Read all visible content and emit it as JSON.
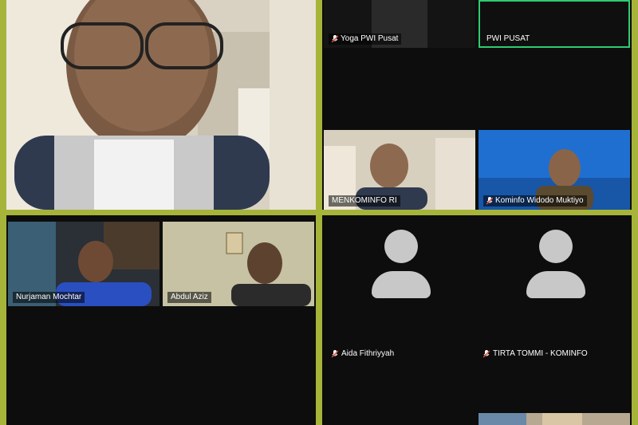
{
  "participants": {
    "yoga": {
      "name": "Yoga PWI Pusat",
      "muted": true
    },
    "pwi": {
      "name": "PWI PUSAT",
      "muted": false,
      "active_speaker": true
    },
    "menkominfo": {
      "name": "MENKOMINFO RI",
      "muted": false
    },
    "widodo": {
      "name": "Kominfo Widodo Muktiyo",
      "muted": true
    },
    "nurjaman": {
      "name": "Nurjaman Mochtar",
      "muted": false
    },
    "abdul": {
      "name": "Abdul Aziz",
      "muted": false
    },
    "aida": {
      "name": "Aida Fithriyyah",
      "muted": true
    },
    "tirta": {
      "name": "TIRTA TOMMI - KOMINFO",
      "muted": true
    }
  },
  "colors": {
    "frame_border": "#a6b43a",
    "active_speaker_border": "#2ecc71",
    "tile_background": "#0d0d0d",
    "avatar_placeholder": "#c8c8c8"
  },
  "icons": {
    "muted": "muted-mic-icon",
    "avatar": "user-avatar-icon"
  }
}
